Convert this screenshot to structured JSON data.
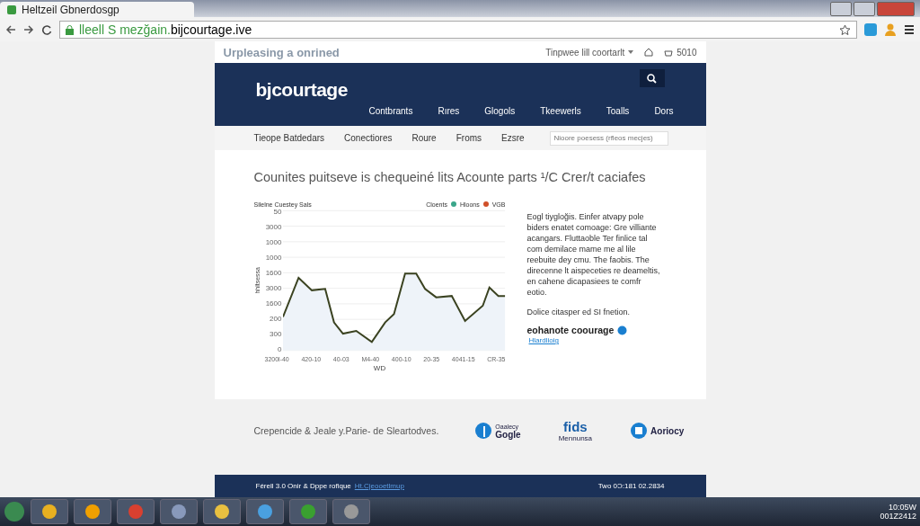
{
  "browser": {
    "tab_title": "Heltzeil Gbnerdosgp",
    "url_prefix": "lleell  S mezğain.",
    "url_domain": "bijcourtage.ive"
  },
  "topbar": {
    "tagline": "Urpleasing a onrined",
    "dropdown": "Tinpwee lill coortarlt",
    "count": "5010"
  },
  "header": {
    "logo": "bjcourtage",
    "nav": [
      {
        "label": "Contbrants",
        "selected": false
      },
      {
        "label": "Rıres",
        "selected": false
      },
      {
        "label": "Glogols",
        "selected": false
      },
      {
        "label": "Tkeewerls",
        "selected": false
      },
      {
        "label": "Toalls",
        "selected": false
      },
      {
        "label": "Dors",
        "selected": false
      }
    ]
  },
  "subnav": {
    "items": [
      "Tieope Batdedars",
      "Conectiores",
      "Roure",
      "Froms",
      "Ezsre"
    ],
    "search_placeholder": "Nioore poesess (rfleos mecjes)"
  },
  "main": {
    "heading": "Counites puitseve is chequeiné lits Acounte parts ¹/C Crer/t caciafes",
    "chart": {
      "title": "Silelne Cuestey Sals",
      "ylabel": "hhltsessa",
      "xlabel": "WD",
      "legend": [
        {
          "label": "Cloents"
        },
        {
          "label": "Hloons",
          "color": "#3aa68a"
        },
        {
          "label": "VGB",
          "color": "#d0502a"
        }
      ],
      "yticks": [
        "50",
        "3000",
        "1000",
        "1000",
        "1600",
        "3000",
        "1600",
        "200",
        "300",
        "0"
      ],
      "xticks": [
        "3200l-40",
        "420-10",
        "40-03",
        "M4-40",
        "400-10",
        "20-35",
        "4041-15",
        "CR-35"
      ]
    },
    "paragraph": "Eogl tiygloğis. Einfer atvapy pole biders enatet comoage: Gre villiante acangars. Fluttaoble Ter finlice tal com demilace mame me al lile reebuite dey cmu. The faobis. The direcenne lt aispeceties re deameltis, en cahene dicapasiees te comfr eotio.",
    "note": "Dolice citasper ed SI fnetion.",
    "brand": "eohanote coourage",
    "brand_link": "Hlardlioig"
  },
  "partners": {
    "text": "Crepencide & Jeale y.Parie- de Sleartodves.",
    "logos": [
      {
        "kind": "round",
        "top": "Oaalecy",
        "bottom": "Gogle"
      },
      {
        "kind": "square",
        "top": "fids",
        "bottom": "Mennunsa"
      },
      {
        "kind": "badge",
        "top": "Aoriocy"
      }
    ]
  },
  "footer": {
    "left": "Férell 3.0  Onir & Dppe rofique",
    "link": "Ht.Cjeooetlmup",
    "right": "Two 0Ɔ:181 02.2834"
  },
  "taskbar": {
    "time": "10:05W",
    "date": "001Z2412"
  }
}
